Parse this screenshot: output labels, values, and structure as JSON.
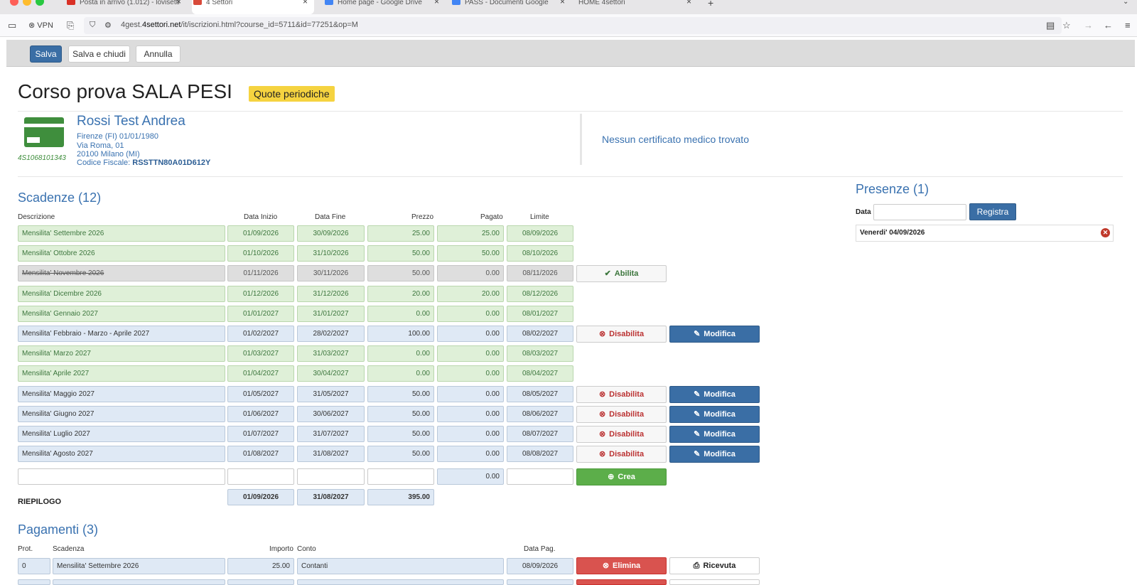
{
  "browser": {
    "tabs": [
      {
        "label": "Posta in arrivo (1.012) - lovisetti",
        "active": false
      },
      {
        "label": "4 Settori",
        "active": true
      },
      {
        "label": "Home page - Google Drive",
        "active": false
      },
      {
        "label": "PASS - Documenti Google",
        "active": false
      },
      {
        "label": "HOME 4settori",
        "active": false
      }
    ],
    "vpn_label": "VPN",
    "url_prefix": "4gest.",
    "url_domain": "4settori.net",
    "url_path": "/it/iscrizioni.html?course_id=5711&id=77251&op=M"
  },
  "toolbar": {
    "save_label": "Salva",
    "save_close_label": "Salva e chiudi",
    "cancel_label": "Annulla"
  },
  "course": {
    "title": "Corso prova SALA PESI",
    "badge": "Quote periodiche"
  },
  "person": {
    "card_id": "4S1068101343",
    "name": "Rossi Test Andrea",
    "birth": "Firenze (FI) 01/01/1980",
    "address": "Via Roma, 01",
    "city": "20100 Milano (MI)",
    "cf_label": "Codice Fiscale:",
    "cf_value": "RSSTTN80A01D612Y"
  },
  "certificate": "Nessun certificato medico trovato",
  "scadenze": {
    "title": "Scadenze (12)",
    "headers": {
      "descr": "Descrizione",
      "start": "Data Inizio",
      "end": "Data Fine",
      "price": "Prezzo",
      "paid": "Pagato",
      "limit": "Limite"
    },
    "rows": [
      {
        "descr": "Mensilita' Settembre 2026",
        "start": "01/09/2026",
        "end": "30/09/2026",
        "price": "25.00",
        "paid": "25.00",
        "limit": "08/09/2026",
        "style": "green",
        "action": "",
        "edit": ""
      },
      {
        "descr": "Mensilita' Ottobre 2026",
        "start": "01/10/2026",
        "end": "31/10/2026",
        "price": "50.00",
        "paid": "50.00",
        "limit": "08/10/2026",
        "style": "green",
        "action": "",
        "edit": ""
      },
      {
        "descr": "Mensilita' Novembre 2026",
        "start": "01/11/2026",
        "end": "30/11/2026",
        "price": "50.00",
        "paid": "0.00",
        "limit": "08/11/2026",
        "style": "gray",
        "action": "Abilita",
        "edit": ""
      },
      {
        "descr": "Mensilita' Dicembre 2026",
        "start": "01/12/2026",
        "end": "31/12/2026",
        "price": "20.00",
        "paid": "20.00",
        "limit": "08/12/2026",
        "style": "green",
        "action": "",
        "edit": ""
      },
      {
        "descr": "Mensilita' Gennaio 2027",
        "start": "01/01/2027",
        "end": "31/01/2027",
        "price": "0.00",
        "paid": "0.00",
        "limit": "08/01/2027",
        "style": "green",
        "action": "",
        "edit": ""
      },
      {
        "descr": "Mensilita' Febbraio - Marzo - Aprile 2027",
        "start": "01/02/2027",
        "end": "28/02/2027",
        "price": "100.00",
        "paid": "0.00",
        "limit": "08/02/2027",
        "style": "blue",
        "action": "Disabilita",
        "edit": "Modifica"
      },
      {
        "descr": "Mensilita' Marzo 2027",
        "start": "01/03/2027",
        "end": "31/03/2027",
        "price": "0.00",
        "paid": "0.00",
        "limit": "08/03/2027",
        "style": "green",
        "action": "",
        "edit": ""
      },
      {
        "descr": "Mensilita' Aprile 2027",
        "start": "01/04/2027",
        "end": "30/04/2027",
        "price": "0.00",
        "paid": "0.00",
        "limit": "08/04/2027",
        "style": "green",
        "action": "",
        "edit": ""
      },
      {
        "descr": "Mensilita' Maggio 2027",
        "start": "01/05/2027",
        "end": "31/05/2027",
        "price": "50.00",
        "paid": "0.00",
        "limit": "08/05/2027",
        "style": "blue",
        "action": "Disabilita",
        "edit": "Modifica"
      },
      {
        "descr": "Mensilita' Giugno 2027",
        "start": "01/06/2027",
        "end": "30/06/2027",
        "price": "50.00",
        "paid": "0.00",
        "limit": "08/06/2027",
        "style": "blue",
        "action": "Disabilita",
        "edit": "Modifica"
      },
      {
        "descr": "Mensilita' Luglio 2027",
        "start": "01/07/2027",
        "end": "31/07/2027",
        "price": "50.00",
        "paid": "0.00",
        "limit": "08/07/2027",
        "style": "blue",
        "action": "Disabilita",
        "edit": "Modifica"
      },
      {
        "descr": "Mensilita' Agosto 2027",
        "start": "01/08/2027",
        "end": "31/08/2027",
        "price": "50.00",
        "paid": "0.00",
        "limit": "08/08/2027",
        "style": "blue",
        "action": "Disabilita",
        "edit": "Modifica"
      }
    ],
    "new_row": {
      "paid": "0.00",
      "create_label": "Crea"
    },
    "summary": {
      "label": "RIEPILOGO",
      "start": "01/09/2026",
      "end": "31/08/2027",
      "price": "395.00"
    }
  },
  "presenze": {
    "title": "Presenze (1)",
    "date_label": "Data",
    "register_label": "Registra",
    "items": [
      "Venerdi' 04/09/2026"
    ]
  },
  "pagamenti": {
    "title": "Pagamenti (3)",
    "headers": {
      "prot": "Prot.",
      "scadenza": "Scadenza",
      "importo": "Importo",
      "conto": "Conto",
      "data": "Data Pag."
    },
    "rows": [
      {
        "prot": "0",
        "scadenza": "Mensilita' Settembre 2026",
        "importo": "25.00",
        "conto": "Contanti",
        "data": "08/09/2026",
        "delete_label": "Elimina",
        "receipt_label": "Ricevuta"
      }
    ]
  },
  "colors": {
    "accent_blue": "#3a6ea5",
    "success_green": "#5cae4a",
    "danger_red": "#d9534f",
    "badge_yellow": "#f5d340"
  }
}
